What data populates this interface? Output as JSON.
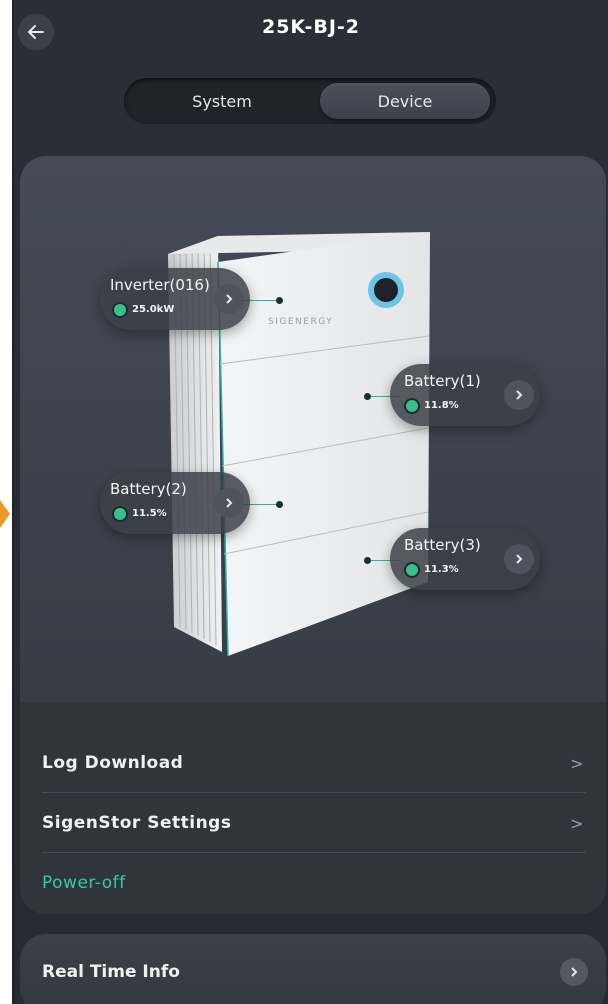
{
  "header": {
    "title": "25K-BJ-2",
    "back_icon": "arrow-left-icon"
  },
  "tabs": [
    {
      "label": "System"
    },
    {
      "label": "Device"
    }
  ],
  "active_tab": "Device",
  "device": {
    "brand": "SIGENERGY",
    "hotspots": [
      {
        "label": "Inverter(016)",
        "value": "25.0kW"
      },
      {
        "label": "Battery(1)",
        "value": "11.8%"
      },
      {
        "label": "Battery(2)",
        "value": "11.5%"
      },
      {
        "label": "Battery(3)",
        "value": "11.3%"
      }
    ],
    "status_color": "#37c08d"
  },
  "menu": {
    "log_download": "Log Download",
    "sigenstor_settings": "SigenStor Settings",
    "power_off": "Power-off",
    "chevron": ">"
  },
  "realtime": {
    "label": "Real Time Info",
    "arrow": ">"
  },
  "colors": {
    "accent": "#37c9a5",
    "left_edge_marker": "#e89a2b"
  }
}
